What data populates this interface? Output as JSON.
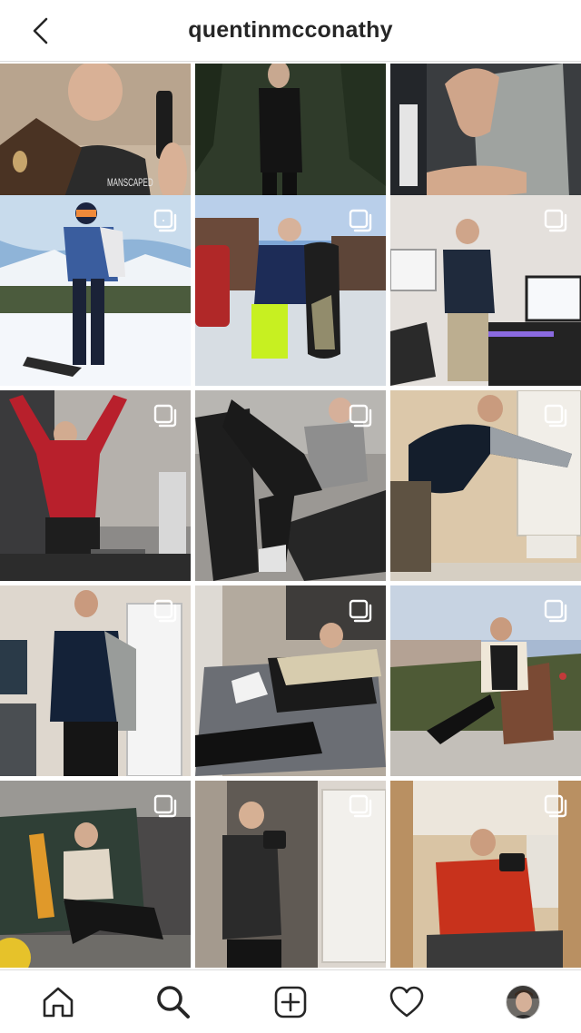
{
  "header": {
    "username": "quentinmcconathy",
    "back_icon": "chevron-left-icon"
  },
  "grid": {
    "posts": [
      {
        "scene": "grooming-product-closeup",
        "multi": false,
        "shirt_text": "MANSCAPED"
      },
      {
        "scene": "forest-snow-black-outfit",
        "multi": false
      },
      {
        "scene": "arm-curl-grey-tank",
        "multi": false
      },
      {
        "scene": "ski-slope-goggles",
        "multi": true
      },
      {
        "scene": "snowboard-parking-lot",
        "multi": true
      },
      {
        "scene": "desk-setup-phone",
        "multi": true
      },
      {
        "scene": "gym-arms-raised-red-hoodie",
        "multi": true
      },
      {
        "scene": "leg-press-peace-sign",
        "multi": true
      },
      {
        "scene": "stretching-by-door",
        "multi": true
      },
      {
        "scene": "standing-peace-navy-sweater",
        "multi": true
      },
      {
        "scene": "couch-lounging",
        "multi": true
      },
      {
        "scene": "outdoor-chair-sunset",
        "multi": true
      },
      {
        "scene": "wall-sitting-skateboard",
        "multi": true
      },
      {
        "scene": "mirror-selfie-tank",
        "multi": true
      },
      {
        "scene": "mirror-selfie-orange-sweater",
        "multi": true
      }
    ]
  },
  "bottom_nav": {
    "items": [
      {
        "name": "home-icon",
        "active": false
      },
      {
        "name": "search-icon",
        "active": true
      },
      {
        "name": "new-post-icon",
        "active": false
      },
      {
        "name": "activity-heart-icon",
        "active": false
      },
      {
        "name": "profile-avatar",
        "active": false
      }
    ]
  },
  "colors": {
    "text": "#262626",
    "divider": "#dbdbdb",
    "background": "#ffffff"
  }
}
